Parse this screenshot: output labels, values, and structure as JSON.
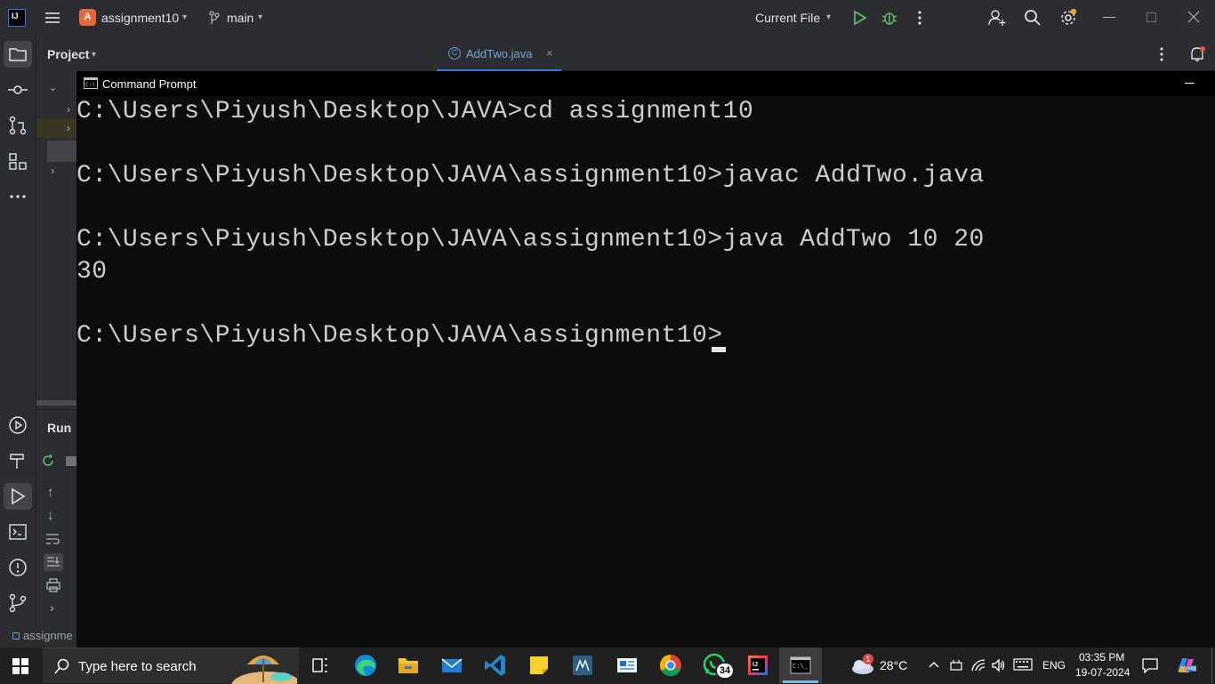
{
  "ide": {
    "project_name": "assignment10",
    "project_letter": "A",
    "logo_text": "IJ",
    "branch": "main",
    "run_config": "Current File",
    "panel_title": "Project",
    "editor_tab": "AddTwo.java",
    "run_panel_title": "Run",
    "status_project": "assignme"
  },
  "cmd": {
    "window_title": "Command Prompt",
    "lines": [
      "C:\\Users\\Piyush\\Desktop\\JAVA>cd assignment10",
      "",
      "C:\\Users\\Piyush\\Desktop\\JAVA\\assignment10>javac AddTwo.java",
      "",
      "C:\\Users\\Piyush\\Desktop\\JAVA\\assignment10>java AddTwo 10 20",
      "30",
      "",
      "C:\\Users\\Piyush\\Desktop\\JAVA\\assignment10>"
    ]
  },
  "taskbar": {
    "search_placeholder": "Type here to search",
    "whatsapp_badge": "34",
    "weather_temp": "28°C",
    "weather_alert": "1",
    "language": "ENG",
    "time": "03:35 PM",
    "date": "19-07-2024"
  },
  "colors": {
    "ide_bg": "#2b2d30",
    "cmd_bg": "#0c0c0c",
    "cmd_text": "#cccccc",
    "taskbar_bg": "#202020",
    "run_green": "#5fb865",
    "accent_blue": "#3574f0"
  }
}
